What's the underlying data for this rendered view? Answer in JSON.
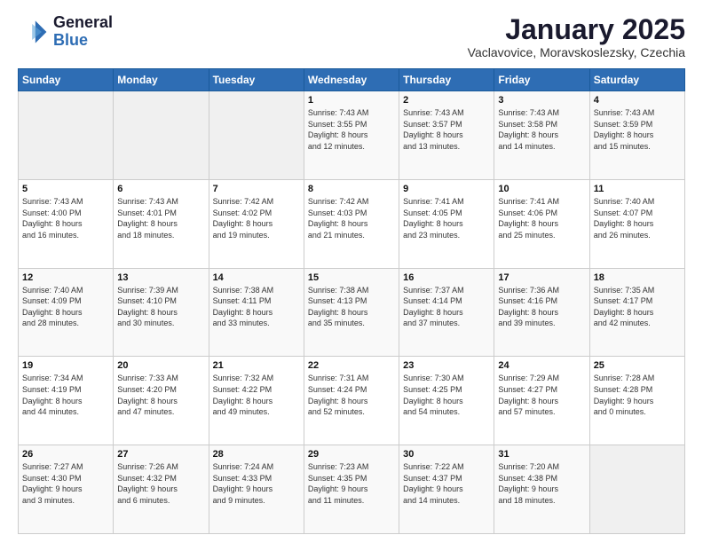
{
  "logo": {
    "line1": "General",
    "line2": "Blue"
  },
  "title": "January 2025",
  "subtitle": "Vaclavovice, Moravskoslezsky, Czechia",
  "days_header": [
    "Sunday",
    "Monday",
    "Tuesday",
    "Wednesday",
    "Thursday",
    "Friday",
    "Saturday"
  ],
  "weeks": [
    [
      {
        "day": "",
        "info": ""
      },
      {
        "day": "",
        "info": ""
      },
      {
        "day": "",
        "info": ""
      },
      {
        "day": "1",
        "info": "Sunrise: 7:43 AM\nSunset: 3:55 PM\nDaylight: 8 hours\nand 12 minutes."
      },
      {
        "day": "2",
        "info": "Sunrise: 7:43 AM\nSunset: 3:57 PM\nDaylight: 8 hours\nand 13 minutes."
      },
      {
        "day": "3",
        "info": "Sunrise: 7:43 AM\nSunset: 3:58 PM\nDaylight: 8 hours\nand 14 minutes."
      },
      {
        "day": "4",
        "info": "Sunrise: 7:43 AM\nSunset: 3:59 PM\nDaylight: 8 hours\nand 15 minutes."
      }
    ],
    [
      {
        "day": "5",
        "info": "Sunrise: 7:43 AM\nSunset: 4:00 PM\nDaylight: 8 hours\nand 16 minutes."
      },
      {
        "day": "6",
        "info": "Sunrise: 7:43 AM\nSunset: 4:01 PM\nDaylight: 8 hours\nand 18 minutes."
      },
      {
        "day": "7",
        "info": "Sunrise: 7:42 AM\nSunset: 4:02 PM\nDaylight: 8 hours\nand 19 minutes."
      },
      {
        "day": "8",
        "info": "Sunrise: 7:42 AM\nSunset: 4:03 PM\nDaylight: 8 hours\nand 21 minutes."
      },
      {
        "day": "9",
        "info": "Sunrise: 7:41 AM\nSunset: 4:05 PM\nDaylight: 8 hours\nand 23 minutes."
      },
      {
        "day": "10",
        "info": "Sunrise: 7:41 AM\nSunset: 4:06 PM\nDaylight: 8 hours\nand 25 minutes."
      },
      {
        "day": "11",
        "info": "Sunrise: 7:40 AM\nSunset: 4:07 PM\nDaylight: 8 hours\nand 26 minutes."
      }
    ],
    [
      {
        "day": "12",
        "info": "Sunrise: 7:40 AM\nSunset: 4:09 PM\nDaylight: 8 hours\nand 28 minutes."
      },
      {
        "day": "13",
        "info": "Sunrise: 7:39 AM\nSunset: 4:10 PM\nDaylight: 8 hours\nand 30 minutes."
      },
      {
        "day": "14",
        "info": "Sunrise: 7:38 AM\nSunset: 4:11 PM\nDaylight: 8 hours\nand 33 minutes."
      },
      {
        "day": "15",
        "info": "Sunrise: 7:38 AM\nSunset: 4:13 PM\nDaylight: 8 hours\nand 35 minutes."
      },
      {
        "day": "16",
        "info": "Sunrise: 7:37 AM\nSunset: 4:14 PM\nDaylight: 8 hours\nand 37 minutes."
      },
      {
        "day": "17",
        "info": "Sunrise: 7:36 AM\nSunset: 4:16 PM\nDaylight: 8 hours\nand 39 minutes."
      },
      {
        "day": "18",
        "info": "Sunrise: 7:35 AM\nSunset: 4:17 PM\nDaylight: 8 hours\nand 42 minutes."
      }
    ],
    [
      {
        "day": "19",
        "info": "Sunrise: 7:34 AM\nSunset: 4:19 PM\nDaylight: 8 hours\nand 44 minutes."
      },
      {
        "day": "20",
        "info": "Sunrise: 7:33 AM\nSunset: 4:20 PM\nDaylight: 8 hours\nand 47 minutes."
      },
      {
        "day": "21",
        "info": "Sunrise: 7:32 AM\nSunset: 4:22 PM\nDaylight: 8 hours\nand 49 minutes."
      },
      {
        "day": "22",
        "info": "Sunrise: 7:31 AM\nSunset: 4:24 PM\nDaylight: 8 hours\nand 52 minutes."
      },
      {
        "day": "23",
        "info": "Sunrise: 7:30 AM\nSunset: 4:25 PM\nDaylight: 8 hours\nand 54 minutes."
      },
      {
        "day": "24",
        "info": "Sunrise: 7:29 AM\nSunset: 4:27 PM\nDaylight: 8 hours\nand 57 minutes."
      },
      {
        "day": "25",
        "info": "Sunrise: 7:28 AM\nSunset: 4:28 PM\nDaylight: 9 hours\nand 0 minutes."
      }
    ],
    [
      {
        "day": "26",
        "info": "Sunrise: 7:27 AM\nSunset: 4:30 PM\nDaylight: 9 hours\nand 3 minutes."
      },
      {
        "day": "27",
        "info": "Sunrise: 7:26 AM\nSunset: 4:32 PM\nDaylight: 9 hours\nand 6 minutes."
      },
      {
        "day": "28",
        "info": "Sunrise: 7:24 AM\nSunset: 4:33 PM\nDaylight: 9 hours\nand 9 minutes."
      },
      {
        "day": "29",
        "info": "Sunrise: 7:23 AM\nSunset: 4:35 PM\nDaylight: 9 hours\nand 11 minutes."
      },
      {
        "day": "30",
        "info": "Sunrise: 7:22 AM\nSunset: 4:37 PM\nDaylight: 9 hours\nand 14 minutes."
      },
      {
        "day": "31",
        "info": "Sunrise: 7:20 AM\nSunset: 4:38 PM\nDaylight: 9 hours\nand 18 minutes."
      },
      {
        "day": "",
        "info": ""
      }
    ]
  ]
}
